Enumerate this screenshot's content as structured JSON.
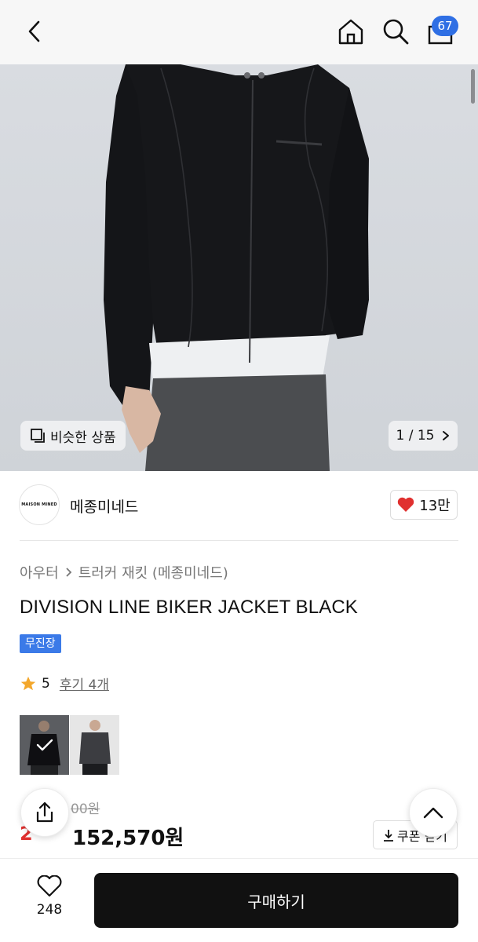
{
  "header": {
    "cart_count": "67",
    "icons": [
      "back-arrow-icon",
      "home-icon",
      "search-icon",
      "cart-icon"
    ]
  },
  "hero": {
    "similar_label": "비슷한 상품",
    "page_indicator": "1 / 15",
    "current_image": 1,
    "total_images": 15
  },
  "brand": {
    "logo_text": "MAISON MINED",
    "name": "메종미네드",
    "likes": "13만"
  },
  "product": {
    "breadcrumb": [
      "아우터",
      "트러커 재킷 (메종미네드)"
    ],
    "title": "DIVISION LINE BIKER JACKET BLACK",
    "tag": "무진장",
    "rating": "5",
    "review_link": "후기 4개",
    "original_price": "00원",
    "discount": "2",
    "price": "152,570원",
    "coupon_label": "쿠폰 받기"
  },
  "bottom_bar": {
    "wish_count": "248",
    "buy_label": "구매하기"
  },
  "colors": {
    "accent": "#2f6fe4",
    "discount": "#e0302f",
    "heart": "#e0302f",
    "buy_button": "#111111",
    "star": "#f3a72b"
  }
}
